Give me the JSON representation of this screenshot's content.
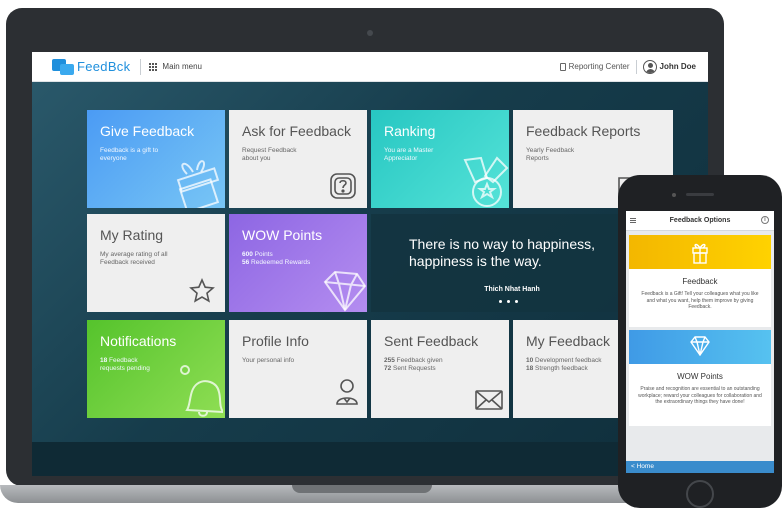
{
  "header": {
    "logo_text": "FeedBck",
    "main_menu_label": "Main menu",
    "reporting_label": "Reporting Center",
    "user_name": "John Doe"
  },
  "tiles": {
    "give": {
      "title": "Give Feedback",
      "subtitle": "Feedback is a gift to everyone"
    },
    "ask": {
      "title": "Ask for Feedback",
      "subtitle": "Request Feedback about you"
    },
    "ranking": {
      "title": "Ranking",
      "subtitle": "You are a Master Appreciator"
    },
    "reports": {
      "title": "Feedback Reports",
      "subtitle": "Yearly Feedback Reports"
    },
    "rating": {
      "title": "My Rating",
      "subtitle": "My average rating of all Feedback received"
    },
    "wow": {
      "title": "WOW Points",
      "points_value": "600",
      "points_label": "Points",
      "redeemed_value": "56",
      "redeemed_label": "Redeemed Rewards"
    },
    "notifications": {
      "title": "Notifications",
      "count_value": "18",
      "count_label": "Feedback requests pending"
    },
    "profile": {
      "title": "Profile Info",
      "subtitle": "Your personal info"
    },
    "sent": {
      "title": "Sent Feedback",
      "given_value": "255",
      "given_label": "Feedback given",
      "requests_value": "72",
      "requests_label": "Sent Requests"
    },
    "my_feedback": {
      "title": "My Feedback",
      "dev_value": "10",
      "dev_label": "Development feedback",
      "strength_value": "18",
      "strength_label": "Strength feedback"
    }
  },
  "quote": {
    "text": "There is no way to happiness, happiness is the way.",
    "author": "Thich Nhat Hanh"
  },
  "phone": {
    "title": "Feedback Options",
    "info_label": "i",
    "cards": [
      {
        "title": "Feedback",
        "text": "Feedback is a Gift! Tell your colleagues what you like and what you want, help them improve by giving Feedback."
      },
      {
        "title": "WOW Points",
        "text": "Praise and recognition are essential to an outstanding workplace; reward your colleagues for collaboration and the extraordinary things they have done!"
      }
    ],
    "footer_label": "Home",
    "back_icon": "<"
  },
  "colors": {
    "give": "#4b9bf4",
    "ranking": "#27c7c2",
    "wow": "#8d66e3",
    "notifications": "#55c32c",
    "brand": "#1f8fdc",
    "phone_feedback_banner": "#f3b700",
    "phone_wow_banner": "#3f9ae6"
  },
  "icons": [
    "gift-icon",
    "help-question-icon",
    "medal-icon",
    "report-document-icon",
    "star-icon",
    "diamond-icon",
    "bell-icon",
    "profile-icon",
    "envelope-icon",
    "feedback-list-icon"
  ]
}
